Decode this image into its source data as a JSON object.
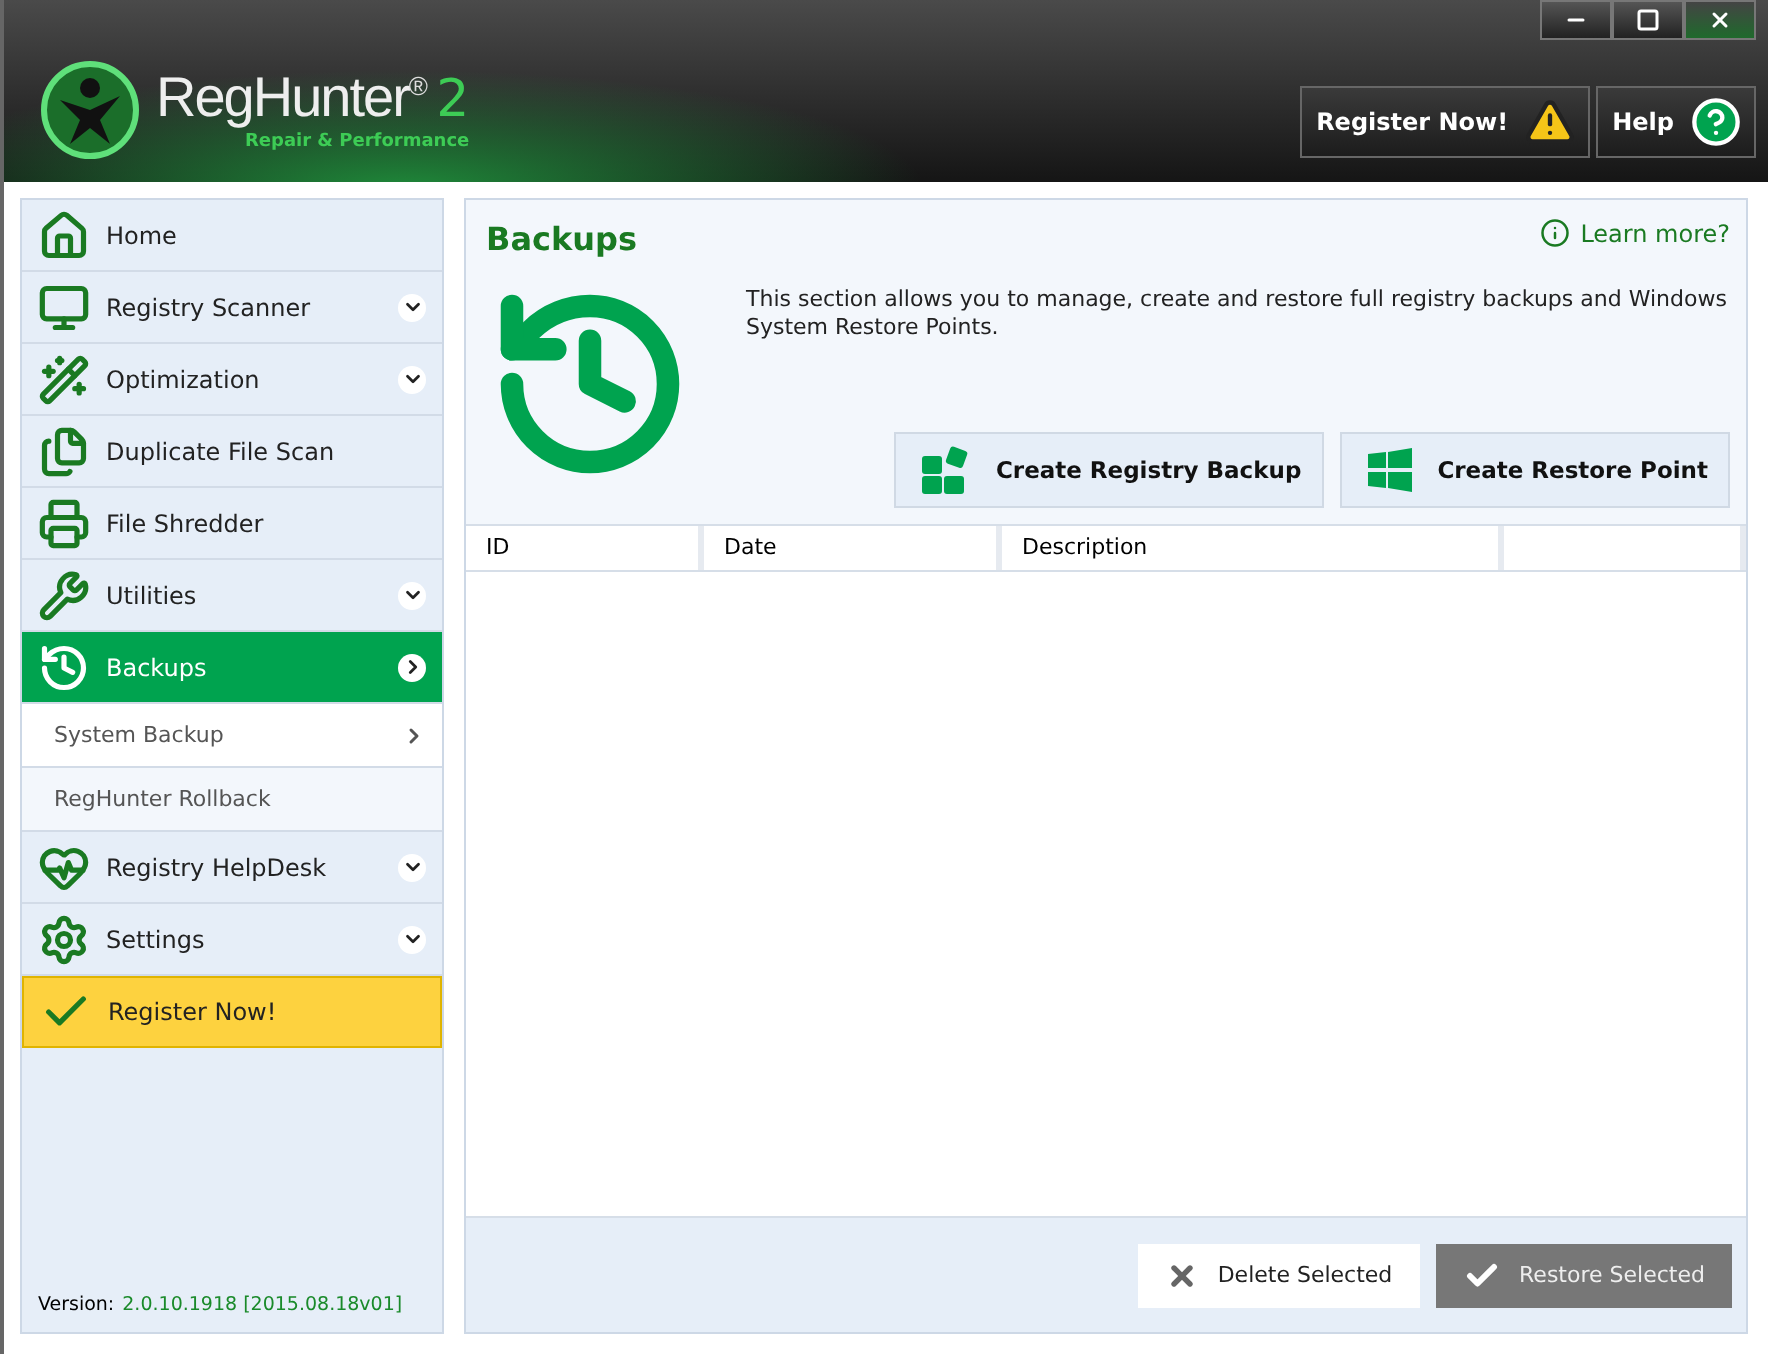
{
  "logo": {
    "name": "RegHunter",
    "mark": "®",
    "version": "2",
    "tagline": "Repair & Performance"
  },
  "header_buttons": [
    {
      "label": "Register Now!",
      "kind": "warning"
    },
    {
      "label": "Help",
      "kind": "help"
    }
  ],
  "sidebar": {
    "items": [
      {
        "label": "Home",
        "kind": "main",
        "expandable": false,
        "selected": false
      },
      {
        "label": "Registry Scanner",
        "kind": "main",
        "expandable": true,
        "selected": false
      },
      {
        "label": "Optimization",
        "kind": "main",
        "expandable": true,
        "selected": false
      },
      {
        "label": "Duplicate File Scan",
        "kind": "main",
        "expandable": false,
        "selected": false
      },
      {
        "label": "File Shredder",
        "kind": "main",
        "expandable": false,
        "selected": false
      },
      {
        "label": "Utilities",
        "kind": "main",
        "expandable": true,
        "selected": false
      },
      {
        "label": "Backups",
        "kind": "main",
        "expandable": true,
        "selected": true
      },
      {
        "label": "System Backup",
        "kind": "sub",
        "selected": true
      },
      {
        "label": "RegHunter Rollback",
        "kind": "sub",
        "selected": false
      },
      {
        "label": "Registry HelpDesk",
        "kind": "main",
        "expandable": true,
        "selected": false
      },
      {
        "label": "Settings",
        "kind": "main",
        "expandable": true,
        "selected": false
      },
      {
        "label": "Register Now!",
        "kind": "register",
        "selected": false
      }
    ],
    "version_label": "Version:",
    "version": "2.0.10.1918 [2015.08.18v01]"
  },
  "section": {
    "title": "Backups",
    "learn_more": "Learn more?",
    "description": "This section allows you to manage, create and restore full registry backups and Windows System Restore Points.",
    "actions": [
      {
        "label": "Create Registry Backup",
        "kind": "registry"
      },
      {
        "label": "Create Restore Point",
        "kind": "restore"
      }
    ]
  },
  "table": {
    "columns": [
      "ID",
      "Date",
      "Description"
    ]
  },
  "footer_buttons": [
    {
      "label": "Delete Selected",
      "kind": "delete",
      "disabled": false
    },
    {
      "label": "Restore Selected",
      "kind": "restore",
      "disabled": true
    }
  ]
}
